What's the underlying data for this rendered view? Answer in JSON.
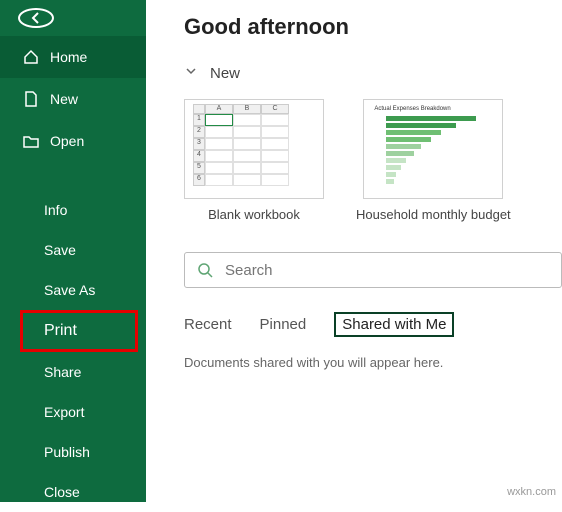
{
  "title": "Good afternoon",
  "sidebar": {
    "home": "Home",
    "new": "New",
    "open": "Open",
    "info": "Info",
    "save": "Save",
    "saveas": "Save As",
    "print": "Print",
    "share": "Share",
    "export": "Export",
    "publish": "Publish",
    "close": "Close"
  },
  "newSection": {
    "label": "New"
  },
  "templates": {
    "blank": "Blank workbook",
    "budget": "Household monthly budget",
    "budget_thumb_title": "Actual Expenses Breakdown"
  },
  "bwCols": [
    "A",
    "B",
    "C"
  ],
  "bwRows": [
    "1",
    "2",
    "3",
    "4",
    "5",
    "6"
  ],
  "search": {
    "placeholder": "Search"
  },
  "tabs": {
    "recent": "Recent",
    "pinned": "Pinned",
    "shared": "Shared with Me"
  },
  "msg": "Documents shared with you will appear here.",
  "watermark": "wxkn.com"
}
